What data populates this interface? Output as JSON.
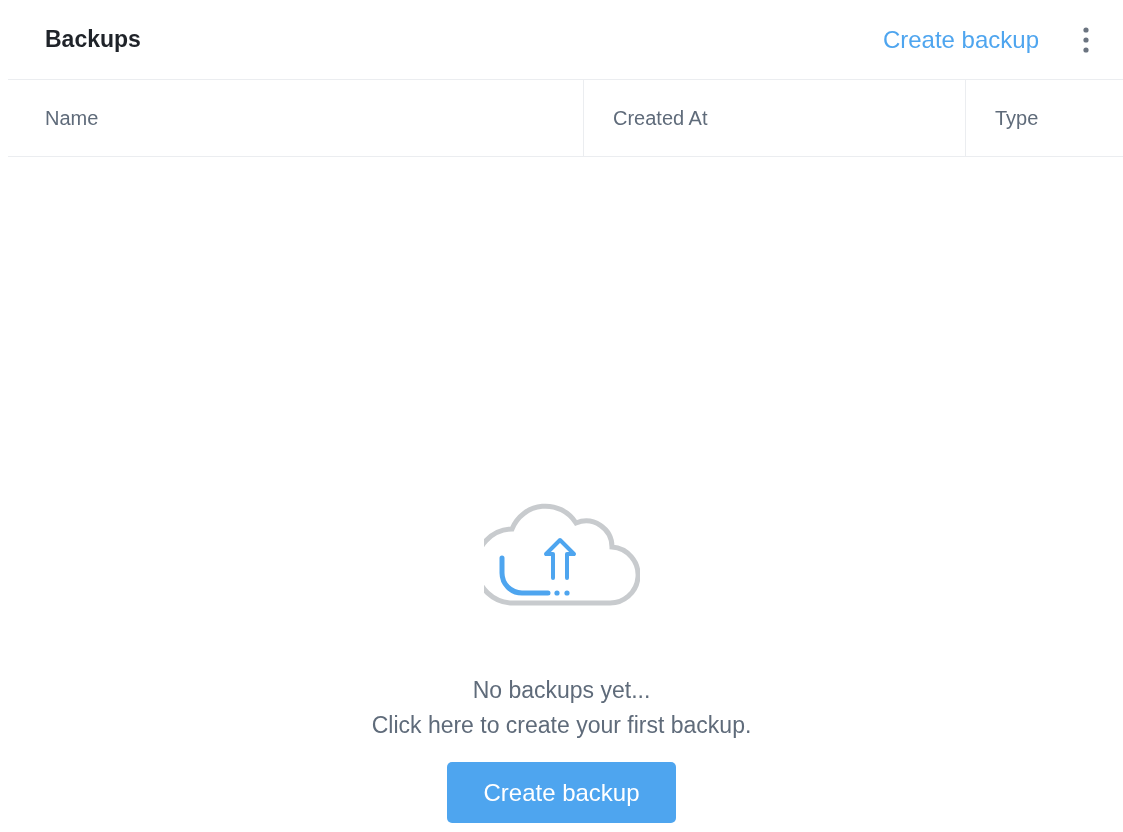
{
  "header": {
    "title": "Backups",
    "action": "Create backup"
  },
  "table": {
    "columns": [
      {
        "label": "Name"
      },
      {
        "label": "Created At"
      },
      {
        "label": "Type"
      }
    ]
  },
  "empty_state": {
    "message": "No backups yet...",
    "hint": "Click here to create your first backup.",
    "button": "Create backup"
  }
}
